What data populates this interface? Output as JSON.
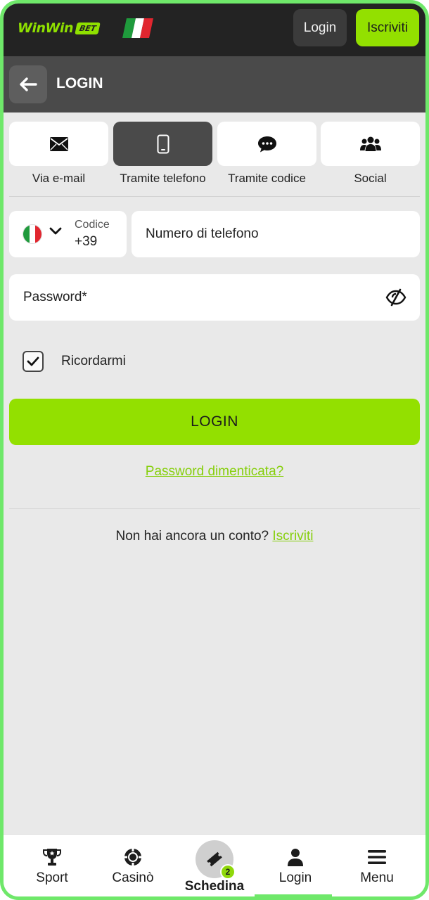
{
  "header": {
    "logo_text": "WinWin",
    "logo_badge": "BET",
    "login_label": "Login",
    "register_label": "Iscriviti",
    "flag_colors": [
      "#1f9a3c",
      "#ffffff",
      "#e1262f"
    ]
  },
  "titlebar": {
    "back_icon": "arrow-left-icon",
    "title": "LOGIN"
  },
  "tabs": [
    {
      "label": "Via e-mail",
      "icon": "envelope-icon",
      "active": false
    },
    {
      "label": "Tramite telefono",
      "icon": "smartphone-icon",
      "active": true
    },
    {
      "label": "Tramite codice",
      "icon": "chat-bubble-icon",
      "active": false
    },
    {
      "label": "Social",
      "icon": "users-icon",
      "active": false
    }
  ],
  "phone": {
    "code_label": "Codice",
    "code_value": "+39",
    "placeholder": "Numero di telefono"
  },
  "password": {
    "placeholder": "Password*"
  },
  "remember": {
    "label": "Ricordarmi",
    "checked": true
  },
  "login_button": "LOGIN",
  "forgot_link": "Password dimenticata?",
  "signup": {
    "prompt": "Non hai ancora un conto?",
    "link": "Iscriviti"
  },
  "accent_color": "#93e000",
  "bottom_nav": [
    {
      "label": "Sport",
      "icon": "trophy-icon"
    },
    {
      "label": "Casinò",
      "icon": "casino-chip-icon"
    },
    {
      "label": "Schedina",
      "icon": "ticket-icon",
      "badge": "2"
    },
    {
      "label": "Login",
      "icon": "user-icon"
    },
    {
      "label": "Menu",
      "icon": "hamburger-menu-icon"
    }
  ]
}
